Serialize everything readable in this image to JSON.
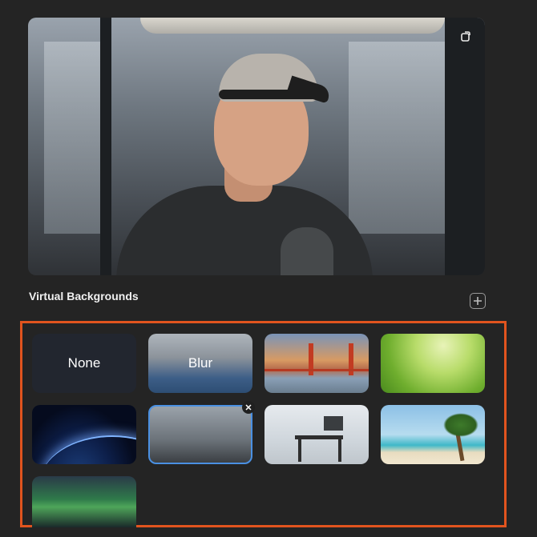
{
  "preview": {
    "rotate_icon": "camera-rotate-icon"
  },
  "virtual_backgrounds": {
    "title": "Virtual Backgrounds",
    "add_icon": "plus-icon",
    "tiles": [
      {
        "label": "None",
        "icon": null
      },
      {
        "label": "Blur",
        "icon": null
      },
      {
        "label": "",
        "icon": "golden-gate-bridge-image"
      },
      {
        "label": "",
        "icon": "grass-image"
      },
      {
        "label": "",
        "icon": "earth-from-space-image"
      },
      {
        "label": "",
        "icon": "office-interior-image",
        "selected": true
      },
      {
        "label": "",
        "icon": "desk-workspace-image"
      },
      {
        "label": "",
        "icon": "beach-palm-image"
      },
      {
        "label": "",
        "icon": "aurora-image"
      }
    ],
    "remove_icon": "close-icon"
  },
  "colors": {
    "background": "#242424",
    "highlight": "#e1541e",
    "selected_border": "#4a90e2"
  }
}
